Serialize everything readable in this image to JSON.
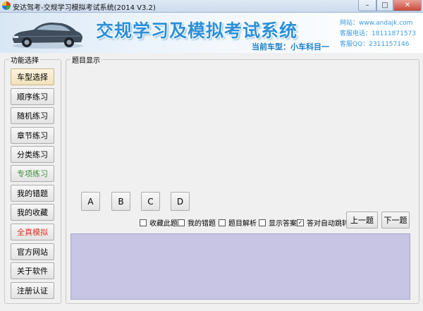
{
  "window": {
    "title": "安达驾考-交规学习模拟考试系统(2014 V3.2)",
    "min_symbol": "–",
    "max_symbol": "□",
    "close_symbol": "✕"
  },
  "banner": {
    "title": "交规学习及模拟考试系统",
    "subtitle": "当前车型：小车科目一",
    "website_label": "网站：",
    "website": "www.andajk.com",
    "phone_label": "客服电话：",
    "phone": "18111871573",
    "qq_label": "客服QQ：",
    "qq": "2311157146"
  },
  "sidebar": {
    "legend": "功能选择",
    "items": [
      {
        "label": "车型选择",
        "color": "#000000",
        "selected": true
      },
      {
        "label": "顺序练习",
        "color": "#000000"
      },
      {
        "label": "随机练习",
        "color": "#000000"
      },
      {
        "label": "章节练习",
        "color": "#000000"
      },
      {
        "label": "分类练习",
        "color": "#000000"
      },
      {
        "label": "专项练习",
        "color": "#3a8f3a"
      },
      {
        "label": "我的错题",
        "color": "#000000"
      },
      {
        "label": "我的收藏",
        "color": "#000000"
      },
      {
        "label": "全真模拟",
        "color": "#e0321e"
      },
      {
        "label": "官方网站",
        "color": "#000000"
      },
      {
        "label": "关于软件",
        "color": "#000000"
      },
      {
        "label": "注册认证",
        "color": "#000000"
      }
    ]
  },
  "main": {
    "legend": "题目显示",
    "question_text": "",
    "options": [
      "A",
      "B",
      "C",
      "D"
    ],
    "checkboxes": [
      {
        "label": "收藏此题",
        "checked": false
      },
      {
        "label": "我的错题",
        "checked": false
      },
      {
        "label": "题目解析",
        "checked": false
      },
      {
        "label": "显示答案",
        "checked": false
      },
      {
        "label": "答对自动跳转",
        "checked": true
      }
    ],
    "prev_label": "上一题",
    "next_label": "下一题",
    "answer_panel_color": "#c7c5e3"
  }
}
